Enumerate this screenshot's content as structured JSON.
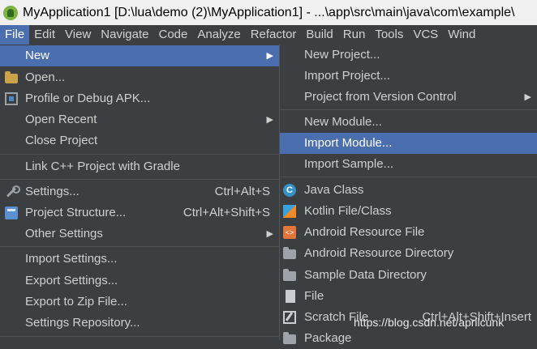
{
  "window": {
    "title": "MyApplication1 [D:\\lua\\demo (2)\\MyApplication1] - ...\\app\\src\\main\\java\\com\\example\\"
  },
  "menubar": {
    "items": [
      "File",
      "Edit",
      "View",
      "Navigate",
      "Code",
      "Analyze",
      "Refactor",
      "Build",
      "Run",
      "Tools",
      "VCS",
      "Wind"
    ]
  },
  "file_menu": {
    "new": "New",
    "open": "Open...",
    "profile_debug_apk": "Profile or Debug APK...",
    "open_recent": "Open Recent",
    "close_project": "Close Project",
    "link_cpp": "Link C++ Project with Gradle",
    "settings": "Settings...",
    "settings_shortcut": "Ctrl+Alt+S",
    "project_structure": "Project Structure...",
    "project_structure_shortcut": "Ctrl+Alt+Shift+S",
    "other_settings": "Other Settings",
    "import_settings": "Import Settings...",
    "export_settings": "Export Settings...",
    "export_zip": "Export to Zip File...",
    "settings_repository": "Settings Repository..."
  },
  "new_submenu": {
    "new_project": "New Project...",
    "import_project": "Import Project...",
    "project_from_vcs": "Project from Version Control",
    "new_module": "New Module...",
    "import_module": "Import Module...",
    "import_sample": "Import Sample...",
    "java_class": "Java Class",
    "kotlin_file": "Kotlin File/Class",
    "android_resource_file": "Android Resource File",
    "android_resource_directory": "Android Resource Directory",
    "sample_data_directory": "Sample Data Directory",
    "file": "File",
    "scratch_file": "Scratch File",
    "scratch_shortcut": "Ctrl+Alt+Shift+Insert",
    "package": "Package"
  },
  "icons": {
    "java_class_glyph": "C",
    "resource_glyph": "<>"
  },
  "watermark": "https://blog.csdn.net/aprilcunk",
  "colors": {
    "menu_bg": "#3c3f41",
    "selection": "#4b6eaf",
    "titlebar_bg": "#f0f0f0"
  }
}
